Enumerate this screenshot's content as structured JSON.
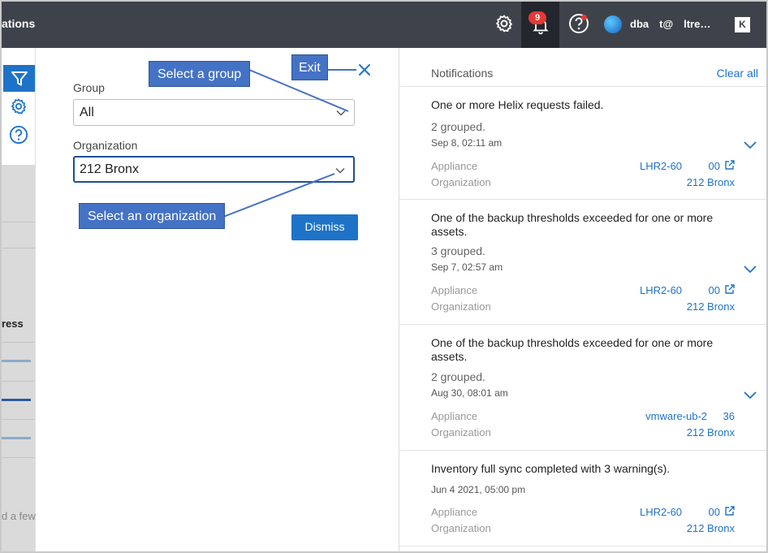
{
  "header": {
    "title_fragment": "ations",
    "notification_count": "9",
    "user_name": "dba  t@  ltre…",
    "kbox_label": "K"
  },
  "left_strip": {
    "partial_heading": "ress",
    "partial_footer": "d a few"
  },
  "filter": {
    "group_label": "Group",
    "group_value": "All",
    "organization_label": "Organization",
    "organization_value": "212 Bronx",
    "dismiss_label": "Dismiss"
  },
  "callouts": {
    "select_group": "Select a group",
    "exit": "Exit",
    "select_org": "Select an organization"
  },
  "notifications": {
    "title": "Notifications",
    "clear_all": "Clear all",
    "items": [
      {
        "message": "One or more Helix requests failed.",
        "grouped": "2 grouped.",
        "date": "Sep 8, 02:11 am",
        "appliance_label": "Appliance",
        "appliance_value": "LHR2-60     00",
        "organization_label": "Organization",
        "organization_value": "212 Bronx"
      },
      {
        "message": "One of the backup thresholds exceeded for one or more assets.",
        "grouped": "3 grouped.",
        "date": "Sep 7, 02:57 am",
        "appliance_label": "Appliance",
        "appliance_value": "LHR2-60     00",
        "organization_label": "Organization",
        "organization_value": "212 Bronx"
      },
      {
        "message": "One of the backup thresholds exceeded for one or more assets.",
        "grouped": "2 grouped.",
        "date": "Aug 30, 08:01 am",
        "appliance_label": "Appliance",
        "appliance_value": "vmware-ub-2   36",
        "organization_label": "Organization",
        "organization_value": "212 Bronx"
      },
      {
        "message": "Inventory full sync completed with 3 warning(s).",
        "grouped": "",
        "date": "Jun 4 2021, 05:00 pm",
        "appliance_label": "Appliance",
        "appliance_value": "LHR2-60     00",
        "organization_label": "Organization",
        "organization_value": "212 Bronx"
      }
    ]
  },
  "colors": {
    "topbar": "#3e434b",
    "accent": "#1e73c8",
    "callout": "#4472c4",
    "badge": "#e53935"
  }
}
